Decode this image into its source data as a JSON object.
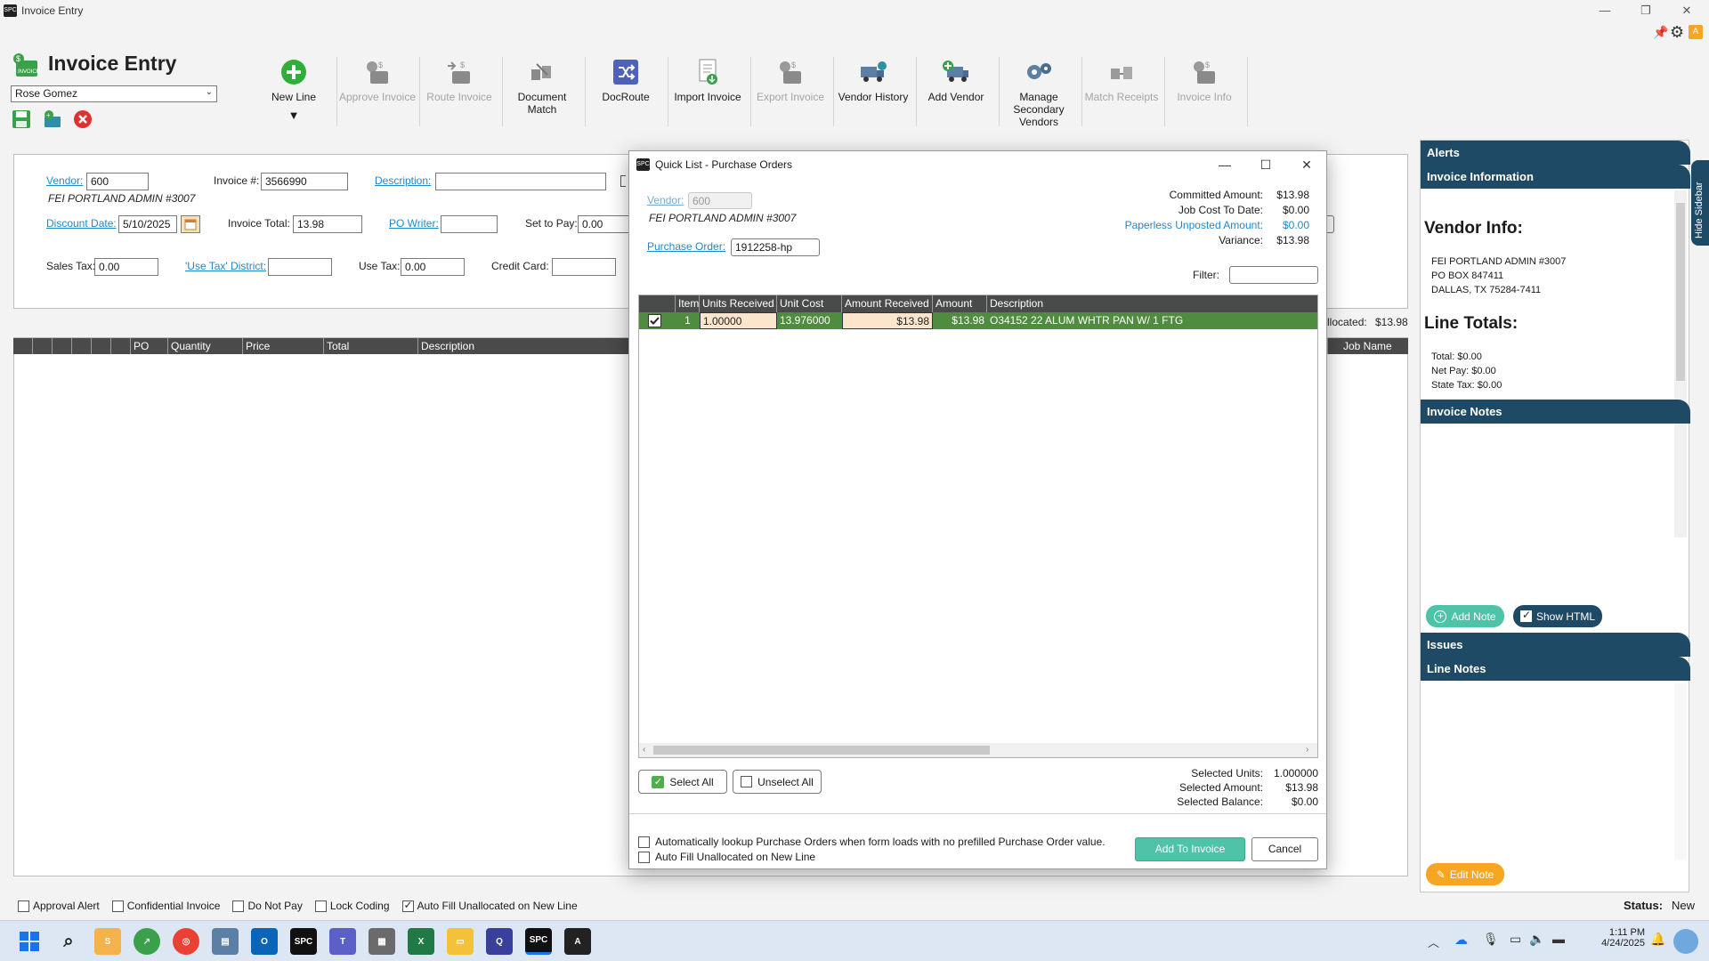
{
  "window": {
    "title": "Invoice Entry"
  },
  "toolbar": {
    "page_title": "Invoice Entry",
    "user": "Rose Gomez",
    "buttons": [
      {
        "label": "New Line",
        "enabled": true,
        "icon": "plus-circle-icon"
      },
      {
        "label": "Approve Invoice",
        "enabled": false,
        "icon": "approve-invoice-icon"
      },
      {
        "label": "Route Invoice",
        "enabled": false,
        "icon": "route-invoice-icon"
      },
      {
        "label": "Document Match",
        "enabled": true,
        "icon": "document-match-icon"
      },
      {
        "label": "DocRoute",
        "enabled": true,
        "icon": "shuffle-icon"
      },
      {
        "label": "Import Invoice",
        "enabled": true,
        "icon": "import-invoice-icon"
      },
      {
        "label": "Export Invoice",
        "enabled": false,
        "icon": "export-invoice-icon"
      },
      {
        "label": "Vendor History",
        "enabled": true,
        "icon": "truck-history-icon"
      },
      {
        "label": "Add Vendor",
        "enabled": true,
        "icon": "truck-add-icon"
      },
      {
        "label": "Manage Secondary Vendors",
        "enabled": true,
        "icon": "gears-icon"
      },
      {
        "label": "Match Receipts",
        "enabled": false,
        "icon": "match-receipts-icon"
      },
      {
        "label": "Invoice Info",
        "enabled": false,
        "icon": "invoice-info-icon"
      }
    ],
    "new_line_menu_arrow": "▼"
  },
  "form": {
    "vendor_label": "Vendor:",
    "vendor_value": "600",
    "vendor_name": "FEI PORTLAND ADMIN #3007",
    "invoice_no_label": "Invoice #:",
    "invoice_no_value": "3566990",
    "description_label": "Description:",
    "description_value": "",
    "discount_date_label": "Discount Date:",
    "discount_date_value": "5/10/2025",
    "invoice_total_label": "Invoice Total:",
    "invoice_total_value": "13.98",
    "po_writer_label": "PO Writer:",
    "po_writer_value": "",
    "set_to_pay_label": "Set to Pay:",
    "set_to_pay_value": "0.00",
    "sales_tax_label": "Sales Tax:",
    "sales_tax_value": "0.00",
    "use_tax_district_label": "'Use Tax' District:",
    "use_tax_district_value": "",
    "use_tax_label": "Use Tax:",
    "use_tax_value": "0.00",
    "credit_card_label": "Credit Card:",
    "credit_card_value": "",
    "unallocated_label": "llocated:",
    "unallocated_value": "$13.98"
  },
  "grid": {
    "columns": [
      "PO Line",
      "Quantity",
      "Price",
      "Total",
      "Description"
    ],
    "job_name_col": "Job Name"
  },
  "bottom_bar": {
    "options": [
      {
        "label": "Approval Alert",
        "checked": false
      },
      {
        "label": "Confidential Invoice",
        "checked": false
      },
      {
        "label": "Do Not Pay",
        "checked": false
      },
      {
        "label": "Lock Coding",
        "checked": false
      },
      {
        "label": "Auto Fill Unallocated on New Line",
        "checked": true
      }
    ],
    "status_label": "Status:",
    "status_value": "New"
  },
  "sidebar": {
    "hide_label": "Hide Sidebar",
    "alerts": "Alerts",
    "invoice_information": "Invoice Information",
    "vendor_info_title": "Vendor Info:",
    "vendor_lines": [
      "FEI PORTLAND ADMIN #3007",
      "PO BOX 847411",
      "DALLAS, TX 75284-7411"
    ],
    "line_totals_title": "Line Totals:",
    "totals": [
      {
        "label": "Total:",
        "value": "$0.00"
      },
      {
        "label": "Net Pay:",
        "value": "$0.00"
      },
      {
        "label": "State Tax:",
        "value": "$0.00"
      }
    ],
    "invoice_notes": "Invoice Notes",
    "add_note": "Add Note",
    "show_html": "Show HTML",
    "issues": "Issues",
    "line_notes": "Line Notes",
    "edit_note": "Edit Note"
  },
  "dialog": {
    "title": "Quick List - Purchase Orders",
    "vendor_label": "Vendor:",
    "vendor_value": "600",
    "vendor_name": "FEI PORTLAND ADMIN #3007",
    "po_label": "Purchase Order:",
    "po_value": "1912258-hp",
    "filter_label": "Filter:",
    "filter_value": "",
    "summary": [
      {
        "label": "Committed Amount:",
        "value": "$13.98",
        "link": false
      },
      {
        "label": "Job Cost To Date:",
        "value": "$0.00",
        "link": false
      },
      {
        "label": "Paperless Unposted Amount:",
        "value": "$0.00",
        "link": true
      },
      {
        "label": "Variance:",
        "value": "$13.98",
        "link": false
      }
    ],
    "columns": [
      "Item",
      "Units Received",
      "Unit Cost",
      "Amount Received",
      "Amount",
      "Description"
    ],
    "rows": [
      {
        "checked": true,
        "item": "1",
        "units_received": "1.00000",
        "unit_cost": "13.976000",
        "amount_received": "$13.98",
        "amount": "$13.98",
        "description": "O34152 22 ALUM WHTR PAN W/ 1 FTG"
      }
    ],
    "select_all": "Select All",
    "unselect_all": "Unselect All",
    "selected": [
      {
        "label": "Selected Units:",
        "value": "1.000000"
      },
      {
        "label": "Selected Amount:",
        "value": "$13.98"
      },
      {
        "label": "Selected Balance:",
        "value": "$0.00"
      }
    ],
    "auto_lookup_label": "Automatically lookup Purchase Orders when form loads with no prefilled Purchase Order value.",
    "auto_fill_label": "Auto Fill Unallocated on New Line",
    "add_to_invoice": "Add To Invoice",
    "cancel": "Cancel"
  },
  "taskbar": {
    "time": "1:11 PM",
    "date": "4/24/2025"
  },
  "colors": {
    "sidebar_head": "#1e4a66",
    "row_selected": "#4f8c3f",
    "link": "#1e8ac9",
    "teal_button": "#4fc3a8",
    "edit_note_orange": "#f5a623"
  }
}
